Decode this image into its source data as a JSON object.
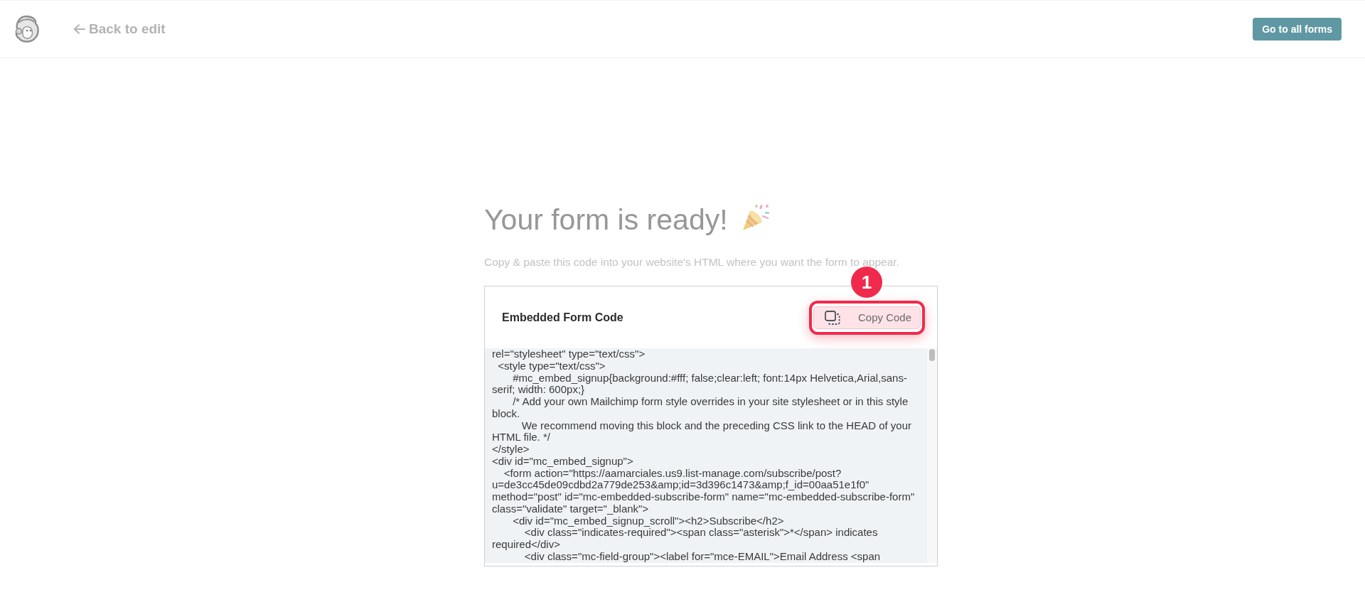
{
  "top_bar": {
    "back_link": "Back to edit",
    "primary_button": "Go to all forms"
  },
  "heading": {
    "title": "Your form is ready!",
    "subtitle": "Copy & paste this code into your website's HTML where you want the form to appear."
  },
  "embed_card": {
    "title": "Embedded Form Code",
    "copy_button": {
      "label": "Copy Code",
      "highlighted": true,
      "step": "1"
    },
    "code": "rel=\"stylesheet\" type=\"text/css\">\n  <style type=\"text/css\">\n       #mc_embed_signup{background:#fff; false;clear:left; font:14px Helvetica,Arial,sans-\nserif; width: 600px;}\n       /* Add your own Mailchimp form style overrides in your site stylesheet or in this style\nblock.\n          We recommend moving this block and the preceding CSS link to the HEAD of your\nHTML file. */\n</style>\n<div id=\"mc_embed_signup\">\n    <form action=\"https://aamarciales.us9.list-manage.com/subscribe/post?\nu=de3cc45de09cdbd2a779de253&amp;id=3d396c1473&amp;f_id=00aa51e1f0\"\nmethod=\"post\" id=\"mc-embedded-subscribe-form\" name=\"mc-embedded-subscribe-form\"\nclass=\"validate\" target=\"_blank\">\n       <div id=\"mc_embed_signup_scroll\"><h2>Subscribe</h2>\n           <div class=\"indicates-required\"><span class=\"asterisk\">*</span> indicates\nrequired</div>\n           <div class=\"mc-field-group\"><label for=\"mce-EMAIL\">Email Address <span"
  }
}
